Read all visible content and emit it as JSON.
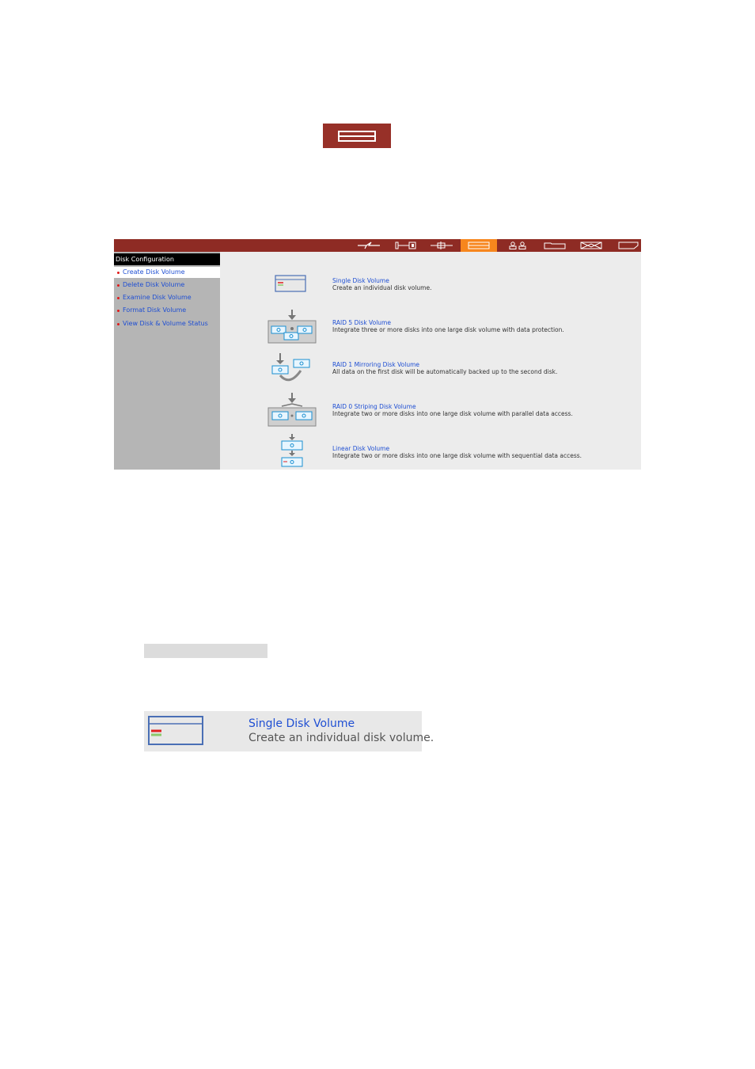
{
  "toolbar": {
    "icons": [
      "lightning-icon",
      "network-icon",
      "connector-icon",
      "disk-config-icon",
      "users-icon",
      "folder-icon",
      "envelope-icon",
      "tag-icon"
    ],
    "active": "disk-config-icon",
    "bar_color": "#8e2b24",
    "active_color": "#f7861d"
  },
  "sidebar": {
    "title": "Disk Configuration",
    "items": [
      {
        "label": "Create Disk Volume"
      },
      {
        "label": "Delete Disk Volume"
      },
      {
        "label": "Examine Disk Volume"
      },
      {
        "label": "Format Disk Volume"
      },
      {
        "label": "View Disk & Volume Status"
      }
    ]
  },
  "options": [
    {
      "icon": "single-disk-icon",
      "title": "Single Disk Volume",
      "desc": "Create an individual disk volume."
    },
    {
      "icon": "raid5-icon",
      "title": "RAID 5 Disk Volume",
      "desc": "Integrate three or more disks into one large disk volume with data protection."
    },
    {
      "icon": "raid1-icon",
      "title": "RAID 1 Mirroring Disk Volume",
      "desc": "All data on the first disk will be automatically backed up to the second disk."
    },
    {
      "icon": "raid0-icon",
      "title": "RAID 0 Striping Disk Volume",
      "desc": "Integrate two or more disks into one large disk volume with parallel data access."
    },
    {
      "icon": "linear-disk-icon",
      "title": "Linear Disk Volume",
      "desc": "Integrate two or more disks into one large disk volume with sequential data access."
    }
  ],
  "zoom": {
    "title": "Single Disk Volume",
    "desc": "Create an individual disk volume."
  }
}
